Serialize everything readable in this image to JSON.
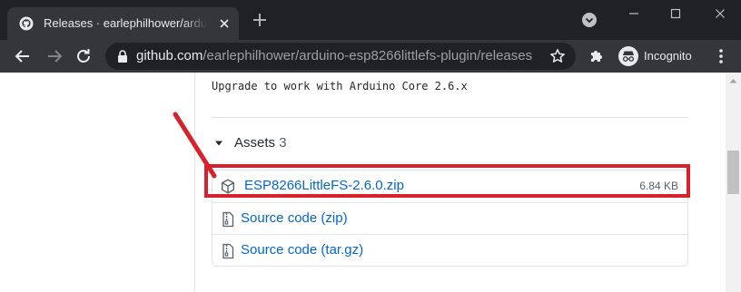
{
  "browser": {
    "tab": {
      "title": "Releases · earlephilhower/arduino-esp8266littlefs-plugin",
      "favicon": "github-icon"
    },
    "address_bar": {
      "host": "github.com",
      "path": "/earlephilhower/arduino-esp8266littlefs-plugin/releases"
    },
    "profile": {
      "label": "Incognito"
    },
    "colors": {
      "frame": "#202124",
      "toolbar": "#35363a"
    }
  },
  "release": {
    "notes_line": "Upgrade to work with Arduino Core 2.6.x",
    "assets": {
      "label": "Assets",
      "count": "3",
      "items": [
        {
          "name": "ESP8266LittleFS-2.6.0.zip",
          "size": "6.84 KB",
          "icon": "package-icon"
        },
        {
          "name": "Source code",
          "format": "(zip)",
          "icon": "file-zip-icon"
        },
        {
          "name": "Source code",
          "format": "(tar.gz)",
          "icon": "file-zip-icon"
        }
      ]
    }
  },
  "annotation": {
    "color": "#d7212b"
  }
}
